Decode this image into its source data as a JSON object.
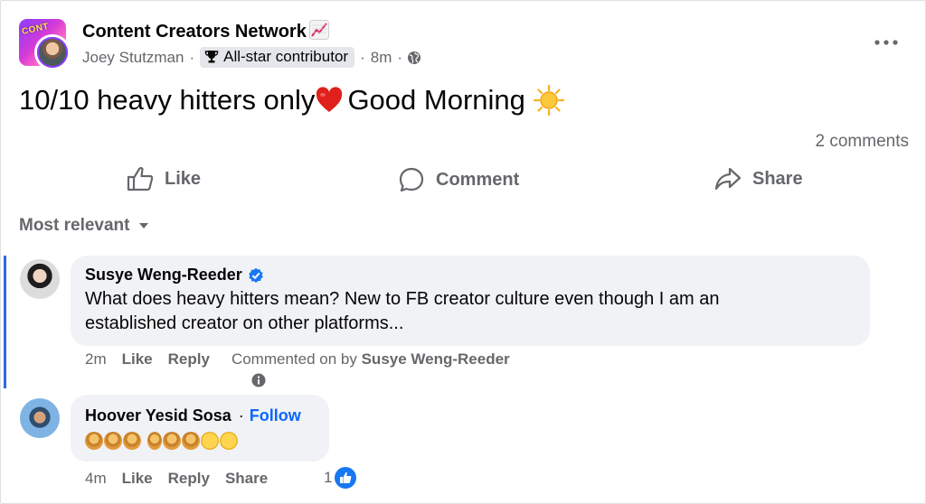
{
  "post": {
    "group_name": "Content Creators Network",
    "group_emoji_icon": "chart-increasing-icon",
    "author": "Joey Stutzman",
    "badge": "All-star contributor",
    "time": "8m",
    "audience_icon": "globe-icon",
    "text_part1": "10/10 heavy hitters only",
    "text_part2": "Good Morning",
    "comments_count": "2 comments"
  },
  "actions": {
    "like": "Like",
    "comment": "Comment",
    "share": "Share"
  },
  "sort_label": "Most relevant",
  "comments": [
    {
      "name": "Susye Weng-Reeder",
      "verified": true,
      "text_line1": "What does heavy hitters mean? New to FB creator culture even though I am an",
      "text_line2": "established creator on other platforms...",
      "time": "2m",
      "like": "Like",
      "reply": "Reply",
      "note_prefix": "Commented on by",
      "note_name": "Susye Weng-Reeder"
    },
    {
      "name": "Hoover Yesid Sosa",
      "follow_separator": "·",
      "follow": "Follow",
      "emoji_text": "🙋🤷💁🙎🙎🙍🥺🥺",
      "time": "4m",
      "like": "Like",
      "reply": "Reply",
      "share": "Share",
      "reactions": "1"
    }
  ],
  "colors": {
    "accent": "#0866ff",
    "secondary_text": "#65676b",
    "bubble": "#f0f2f5",
    "highlight": "#2d6ae3"
  }
}
